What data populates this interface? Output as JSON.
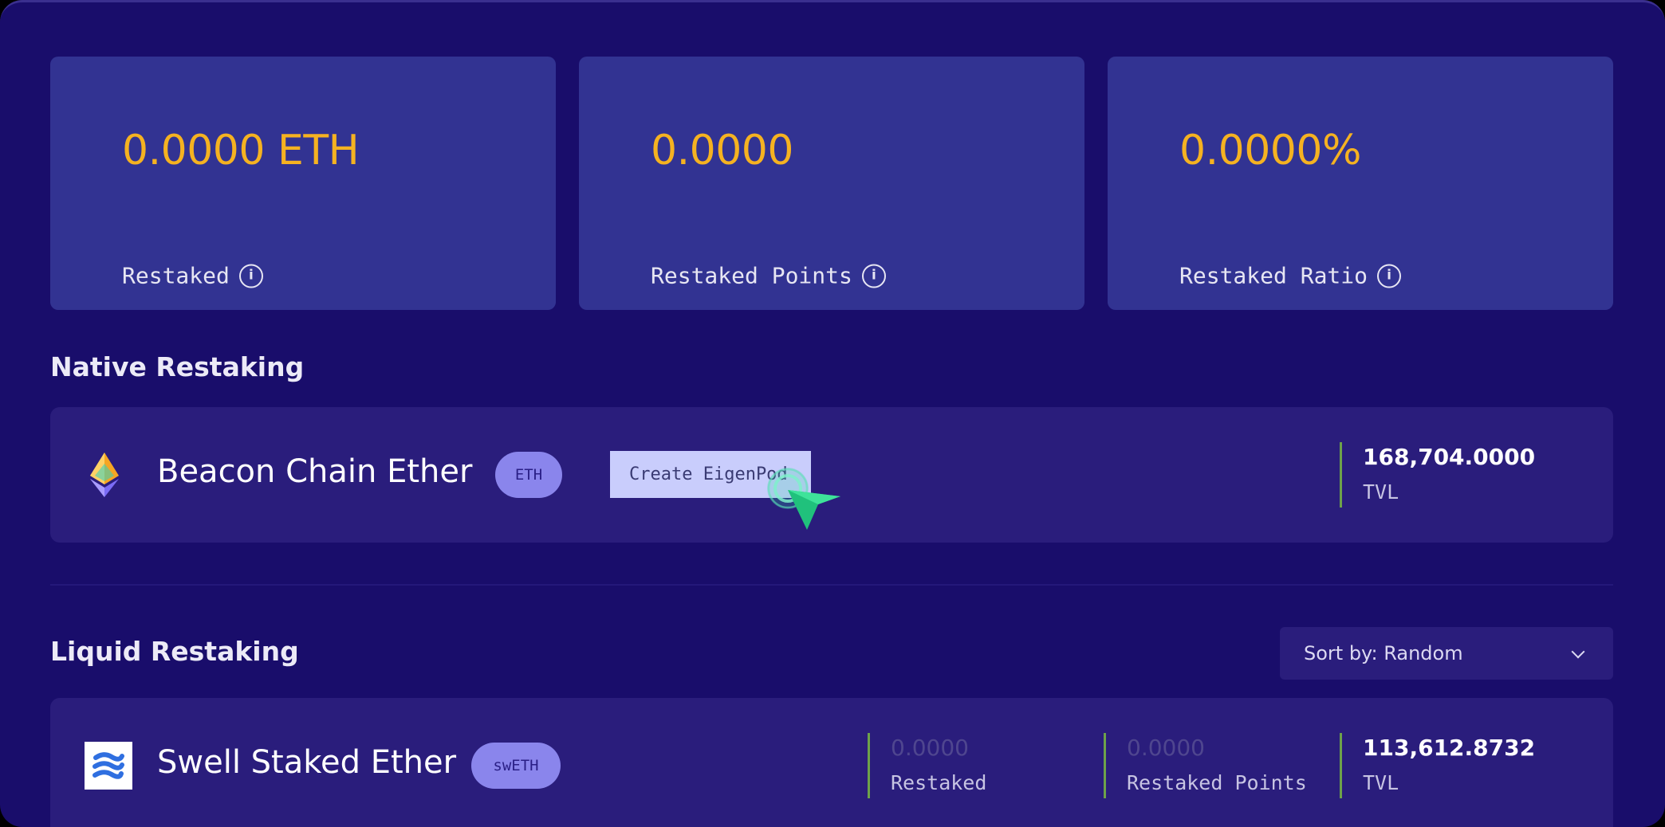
{
  "stats": [
    {
      "value": "0.0000 ETH",
      "label": "Restaked"
    },
    {
      "value": "0.0000",
      "label": "Restaked Points"
    },
    {
      "value": "0.0000%",
      "label": "Restaked Ratio"
    }
  ],
  "native": {
    "title": "Native Restaking",
    "asset": {
      "name": "Beacon Chain Ether",
      "symbol": "ETH",
      "icon": "ethereum-icon",
      "button_label": "Create EigenPod",
      "tvl_value": "168,704.0000",
      "tvl_label": "TVL"
    }
  },
  "liquid": {
    "title": "Liquid Restaking",
    "sort_label": "Sort by: Random",
    "assets": [
      {
        "name": "Swell Staked Ether",
        "symbol": "swETH",
        "icon": "swell-icon",
        "restaked_value": "0.0000",
        "restaked_label": "Restaked",
        "points_value": "0.0000",
        "points_label": "Restaked Points",
        "tvl_value": "113,612.8732",
        "tvl_label": "TVL"
      }
    ]
  },
  "colors": {
    "background": "#190d6b",
    "card": "#323392",
    "row": "#2a1d7c",
    "accent_yellow": "#f5b221",
    "badge": "#8a85ec",
    "divider_green": "#6ea24a"
  }
}
